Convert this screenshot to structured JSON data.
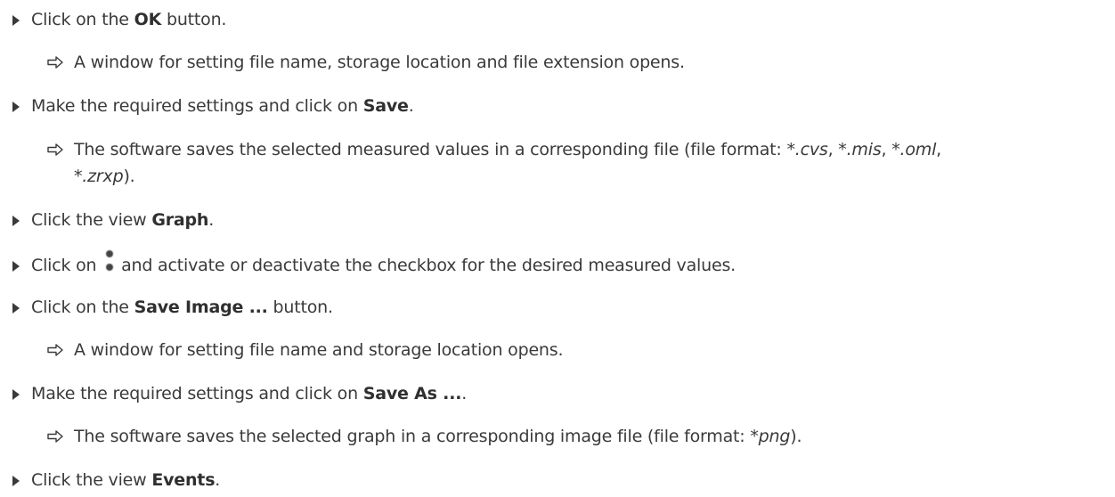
{
  "steps": [
    {
      "pre": "Click on the ",
      "bold": "OK",
      "post": " button."
    },
    {
      "result": "A window for setting file name, storage location and file extension opens."
    },
    {
      "pre": "Make the required settings and click on ",
      "bold": "Save",
      "post": "."
    },
    {
      "result_pre": "The software saves the selected measured values in a corresponding file (file format: ",
      "ext1": "*.cvs",
      "sep1": ", ",
      "ext2": "*.mis",
      "sep2": ", ",
      "ext3": "*.oml",
      "sep3": ",",
      "ext4": "*.zrxp",
      "result_post": ")."
    },
    {
      "pre": "Click the view ",
      "bold": "Graph",
      "post": "."
    },
    {
      "pre": "Click on ",
      "icon": "vertical-dots-icon",
      "post": " and activate or deactivate the checkbox for the desired measured values."
    },
    {
      "pre": "Click on the ",
      "bold": "Save Image ...",
      "post": " button."
    },
    {
      "result": "A window for setting file name and storage location opens."
    },
    {
      "pre": "Make the required settings and click on ",
      "bold": "Save As ...",
      "post": "."
    },
    {
      "result_pre": "The software saves the selected graph in a corresponding image file (file format: ",
      "ext": "*png",
      "result_post": ")."
    },
    {
      "pre": "Click the view ",
      "bold": "Events",
      "post": "."
    }
  ]
}
